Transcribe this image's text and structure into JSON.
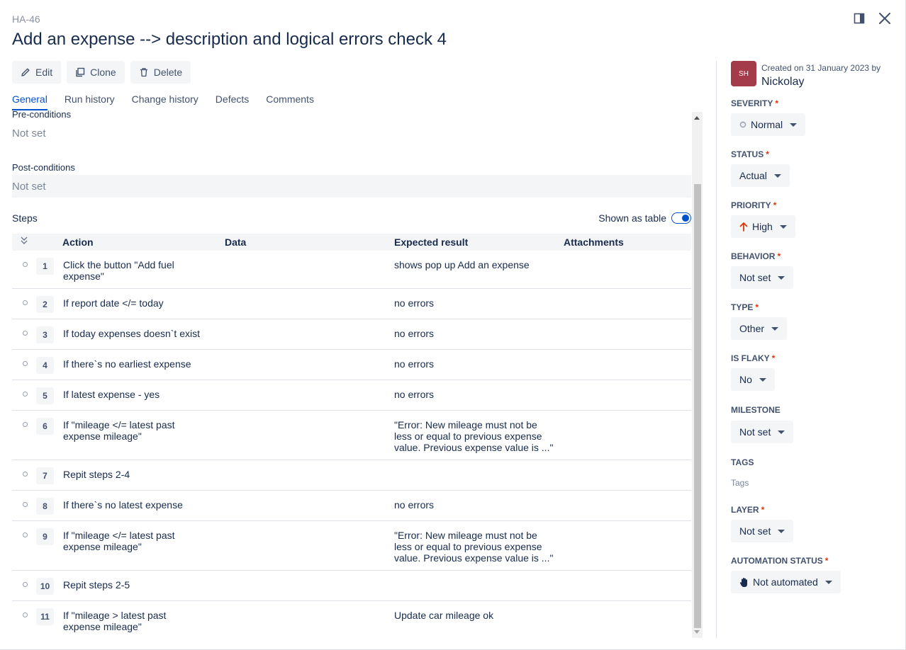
{
  "header": {
    "case_key": "HA-46",
    "title": "Add an expense --> description and logical errors check 4"
  },
  "toolbar": {
    "edit_label": "Edit",
    "clone_label": "Clone",
    "delete_label": "Delete"
  },
  "tabs": [
    {
      "label": "General",
      "active": true
    },
    {
      "label": "Run history",
      "active": false
    },
    {
      "label": "Change history",
      "active": false
    },
    {
      "label": "Defects",
      "active": false
    },
    {
      "label": "Comments",
      "active": false
    }
  ],
  "preconditions": {
    "label": "Pre-conditions",
    "value": "Not set"
  },
  "postconditions": {
    "label": "Post-conditions",
    "value": "Not set"
  },
  "steps": {
    "label": "Steps",
    "toggle_label": "Shown as table",
    "toggle_on": true,
    "columns": [
      "Action",
      "Data",
      "Expected result",
      "Attachments"
    ],
    "rows": [
      {
        "num": "1",
        "action": "Click the button \"Add fuel expense\"",
        "expected": "shows pop up Add an expense"
      },
      {
        "num": "2",
        "action": "If report date </= today",
        "expected": "no errors"
      },
      {
        "num": "3",
        "action": "If today expenses doesn`t exist",
        "expected": "no errors"
      },
      {
        "num": "4",
        "action": "If there`s no earliest expense",
        "expected": "no errors"
      },
      {
        "num": "5",
        "action": "If latest expense - yes",
        "expected": "no errors"
      },
      {
        "num": "6",
        "action": "If \"mileage </= latest past expense mileage\"",
        "expected": "\"Error: New mileage must not be less or equal to previous expense value. Previous expense value is ...\""
      },
      {
        "num": "7",
        "action": "Repit steps 2-4",
        "expected": ""
      },
      {
        "num": "8",
        "action": "If there`s no latest expense",
        "expected": "no errors"
      },
      {
        "num": "9",
        "action": "If \"mileage </= latest past expense mileage\"",
        "expected": "\"Error: New mileage must not be less or equal to previous expense value. Previous expense value is ...\""
      },
      {
        "num": "10",
        "action": "Repit steps 2-5",
        "expected": ""
      },
      {
        "num": "11",
        "action": "If \"mileage > latest past expense mileage\"",
        "expected": "Update car mileage ok"
      }
    ]
  },
  "sidebar": {
    "avatar_initials": "SH",
    "created_text": "Created on 31 January 2023 by",
    "creator": "Nickolay",
    "fields": [
      {
        "label": "SEVERITY",
        "value": "Normal",
        "icon": "circle-outline-icon"
      },
      {
        "label": "STATUS",
        "value": "Actual"
      },
      {
        "label": "PRIORITY",
        "value": "High",
        "icon": "arrow-up-icon"
      },
      {
        "label": "BEHAVIOR",
        "value": "Not set"
      },
      {
        "label": "TYPE",
        "value": "Other"
      },
      {
        "label": "IS FLAKY",
        "value": "No"
      },
      {
        "label": "MILESTONE",
        "value": "Not set"
      },
      {
        "label": "TAGS",
        "value": "Tags"
      },
      {
        "label": "LAYER",
        "value": "Not set"
      },
      {
        "label": "AUTOMATION STATUS",
        "value": "Not automated",
        "icon": "hand-icon"
      }
    ]
  },
  "colors": {
    "accent": "#0052cc",
    "required": "#de350b",
    "priority_high": "#de350b",
    "avatar_bg": "#a33b4a"
  }
}
